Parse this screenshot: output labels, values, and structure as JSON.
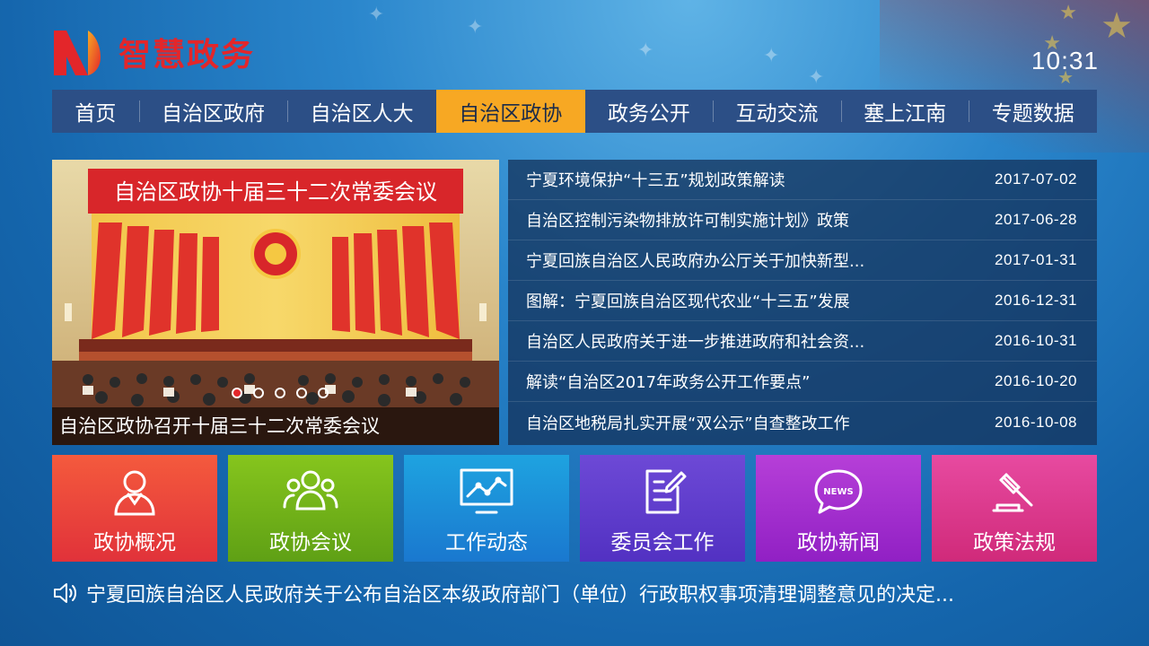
{
  "app": {
    "logo_text": "智慧政务",
    "clock": "10:31"
  },
  "nav": {
    "items": [
      {
        "label": "首页",
        "active": false
      },
      {
        "label": "自治区政府",
        "active": false
      },
      {
        "label": "自治区人大",
        "active": false
      },
      {
        "label": "自治区政协",
        "active": true
      },
      {
        "label": "政务公开",
        "active": false
      },
      {
        "label": "互动交流",
        "active": false
      },
      {
        "label": "塞上江南",
        "active": false
      },
      {
        "label": "专题数据",
        "active": false
      }
    ]
  },
  "hero": {
    "banner_text": "自治区政协十届三十二次常委会议",
    "caption": "自治区政协召开十届三十二次常委会议",
    "dot_count": 5,
    "active_dot": 0
  },
  "news": [
    {
      "title": "宁夏环境保护“十三五”规划政策解读",
      "date": "2017-07-02"
    },
    {
      "title": "自治区控制污染物排放许可制实施计划》政策",
      "date": "2017-06-28"
    },
    {
      "title": "宁夏回族自治区人民政府办公厅关于加快新型...",
      "date": "2017-01-31"
    },
    {
      "title": "图解：宁夏回族自治区现代农业“十三五”发展",
      "date": "2016-12-31"
    },
    {
      "title": "自治区人民政府关于进一步推进政府和社会资...",
      "date": "2016-10-31"
    },
    {
      "title": "解读“自治区2017年政务公开工作要点”",
      "date": "2016-10-20"
    },
    {
      "title": "自治区地税局扎实开展“双公示”自查整改工作",
      "date": "2016-10-08"
    }
  ],
  "tiles": [
    {
      "label": "政协概况",
      "icon": "person-icon"
    },
    {
      "label": "政协会议",
      "icon": "group-icon"
    },
    {
      "label": "工作动态",
      "icon": "chart-monitor-icon"
    },
    {
      "label": "委员会工作",
      "icon": "document-edit-icon"
    },
    {
      "label": "政协新闻",
      "icon": "news-bubble-icon",
      "icon_text": "NEWS"
    },
    {
      "label": "政策法规",
      "icon": "gavel-icon"
    }
  ],
  "ticker": {
    "icon": "speaker-icon",
    "text": "宁夏回族自治区人民政府关于公布自治区本级政府部门（单位）行政职权事项清理调整意见的决定..."
  }
}
